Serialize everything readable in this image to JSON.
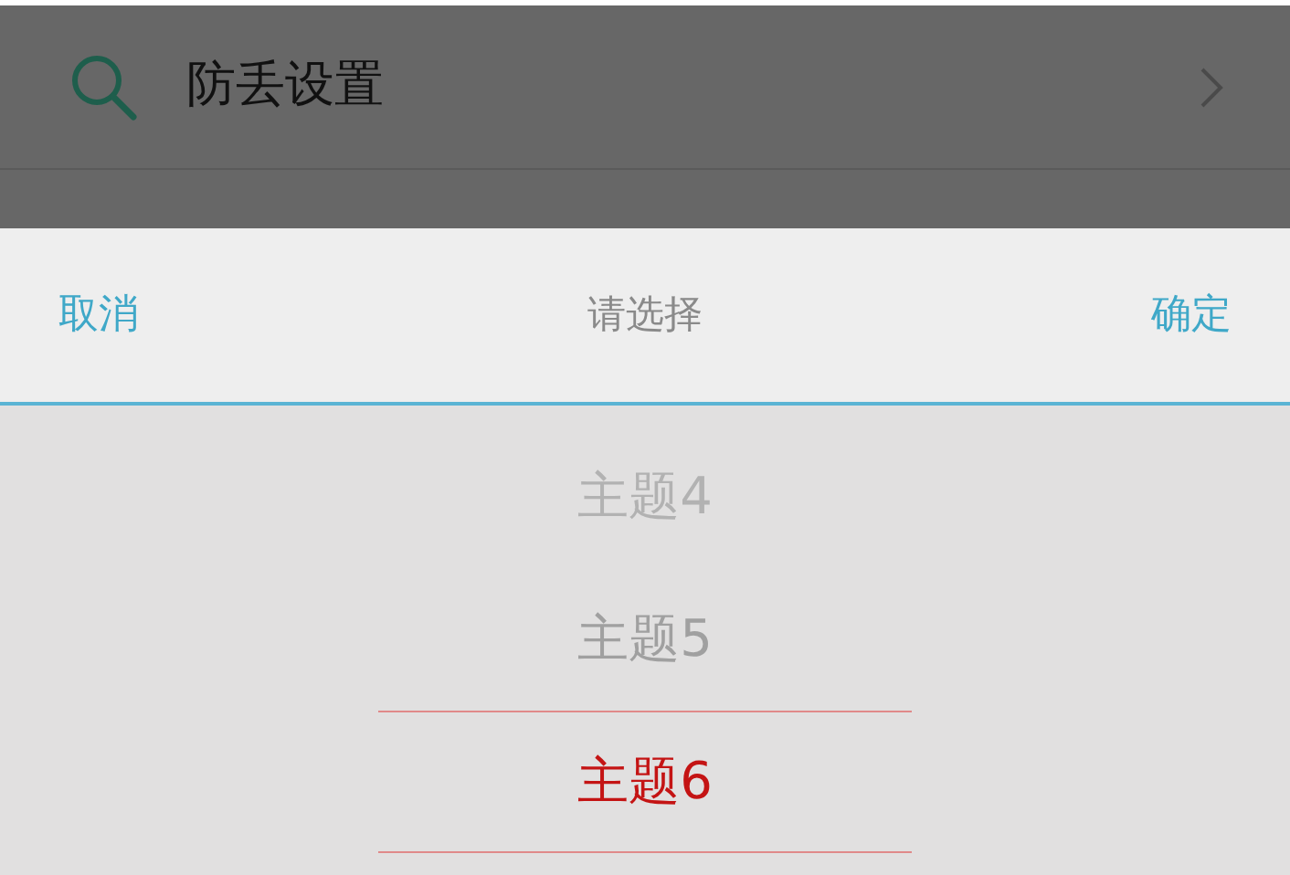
{
  "background_row": {
    "label": "防丢设置"
  },
  "dialog": {
    "cancel": "取消",
    "title": "请选择",
    "confirm": "确定"
  },
  "picker": {
    "items": [
      {
        "label": "主题4",
        "selected": false
      },
      {
        "label": "主题5",
        "selected": false
      },
      {
        "label": "主题6",
        "selected": true
      }
    ]
  }
}
